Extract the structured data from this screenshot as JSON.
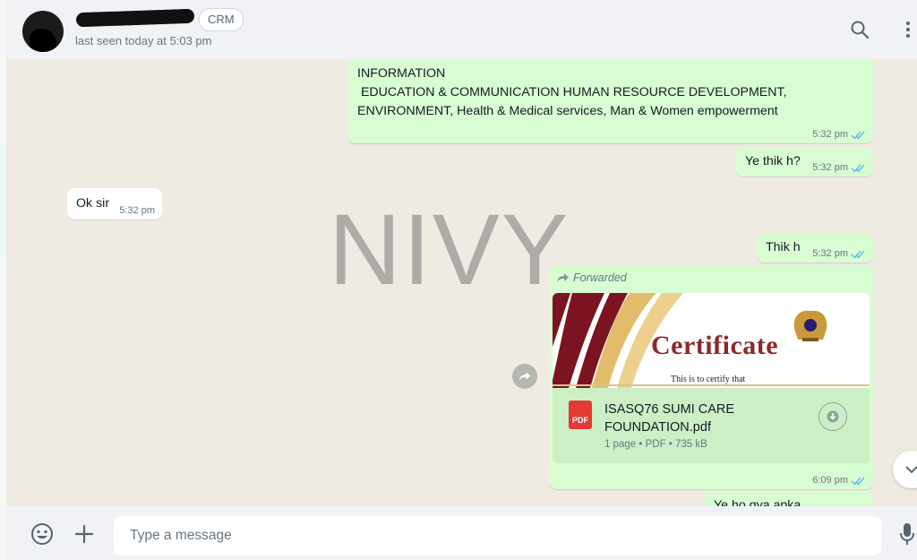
{
  "header": {
    "contact_badge": "CRM",
    "last_seen": "last seen today at 5:03 pm"
  },
  "chat": {
    "watermark": "NIVY",
    "messages": [
      {
        "lines": [
          "INFORMATION",
          " EDUCATION & COMMUNICATION HUMAN RESOURCE DEVELOPMENT,",
          "ENVIRONMENT, Health & Medical services, Man & Women empowerment"
        ],
        "time": "5:32 pm"
      },
      {
        "text": "Ye thik h?",
        "time": "5:32 pm"
      },
      {
        "text": "Ok sir",
        "time": "5:32 pm"
      },
      {
        "text": "Thik h",
        "time": "5:32 pm"
      },
      {
        "forwarded_label": "Forwarded",
        "thumbnail": {
          "title": "Certificate",
          "subtitle": "This is to certify that"
        },
        "document": {
          "icon_label": "PDF",
          "name_line1": "ISASQ76 SUMI CARE",
          "name_line2": "FOUNDATION.pdf",
          "info": "1 page • PDF • 735 kB"
        },
        "time": "6:09 pm"
      },
      {
        "text": "Ye ho gya apka",
        "time": ""
      }
    ]
  },
  "footer": {
    "placeholder": "Type a message"
  },
  "icons": {
    "search": "search-icon",
    "menu": "more-vertical-icon",
    "emoji": "emoji-icon",
    "attach": "plus-icon",
    "mic": "microphone-icon",
    "ticks": "double-check-icon",
    "forward": "forward-arrow-icon",
    "download": "download-icon",
    "share": "share-icon",
    "scroll": "chevron-down-icon"
  },
  "colors": {
    "outgoing_bubble": "#d9fdd3",
    "incoming_bubble": "#ffffff",
    "chat_background": "#efeae2",
    "read_ticks": "#53bdeb",
    "pdf_red": "#e53935"
  }
}
